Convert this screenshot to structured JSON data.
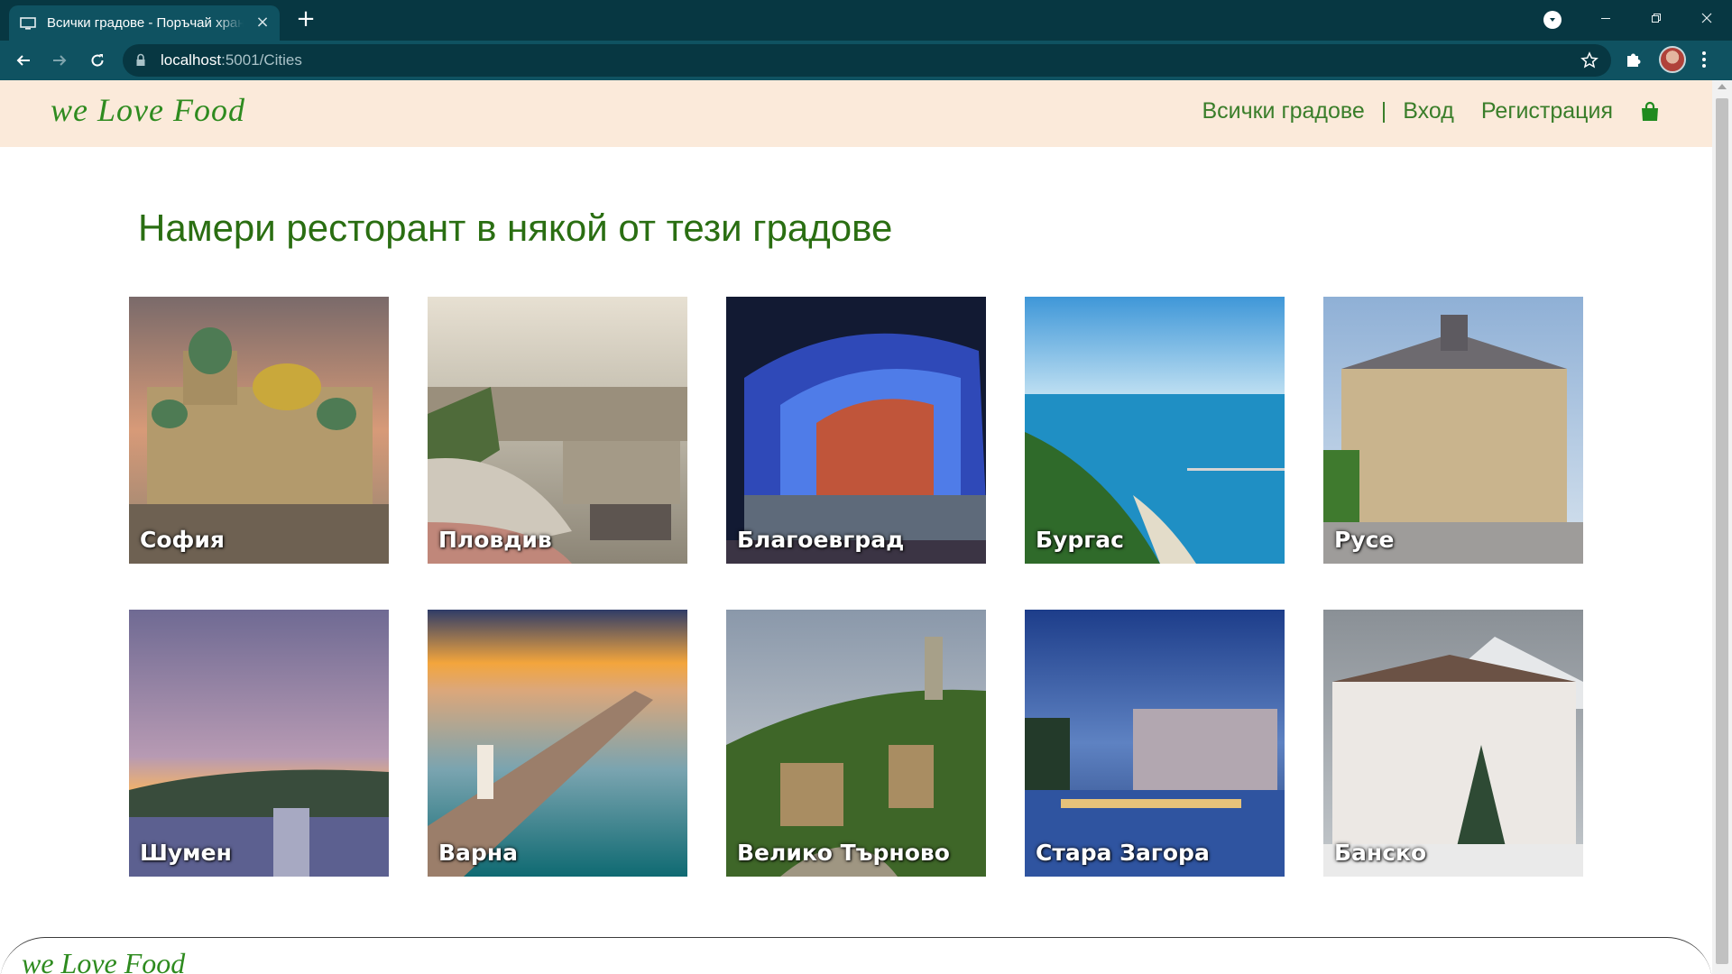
{
  "browser": {
    "tab_title": "Всички градове - Поръчай храна",
    "url_host": "localhost",
    "url_path": ":5001/Cities"
  },
  "header": {
    "brand": "we Love Food",
    "nav": {
      "all_cities": "Всички градове",
      "separator": "|",
      "login": "Вход",
      "register": "Регистрация"
    },
    "cart_icon": "shopping-bag-icon"
  },
  "main": {
    "title": "Намери ресторант в някой от тези градове",
    "cities": [
      {
        "name": "София"
      },
      {
        "name": "Пловдив"
      },
      {
        "name": "Благоевград"
      },
      {
        "name": "Бургас"
      },
      {
        "name": "Русе"
      },
      {
        "name": "Шумен"
      },
      {
        "name": "Варна"
      },
      {
        "name": "Велико Търново"
      },
      {
        "name": "Стара Загора"
      },
      {
        "name": "Банско"
      }
    ]
  },
  "footer": {
    "brand": "we Love Food"
  },
  "colors": {
    "header_bg": "#fbeada",
    "accent_green": "#2a6e12",
    "chrome_dark": "#073742",
    "chrome_toolbar": "#0f5261"
  }
}
